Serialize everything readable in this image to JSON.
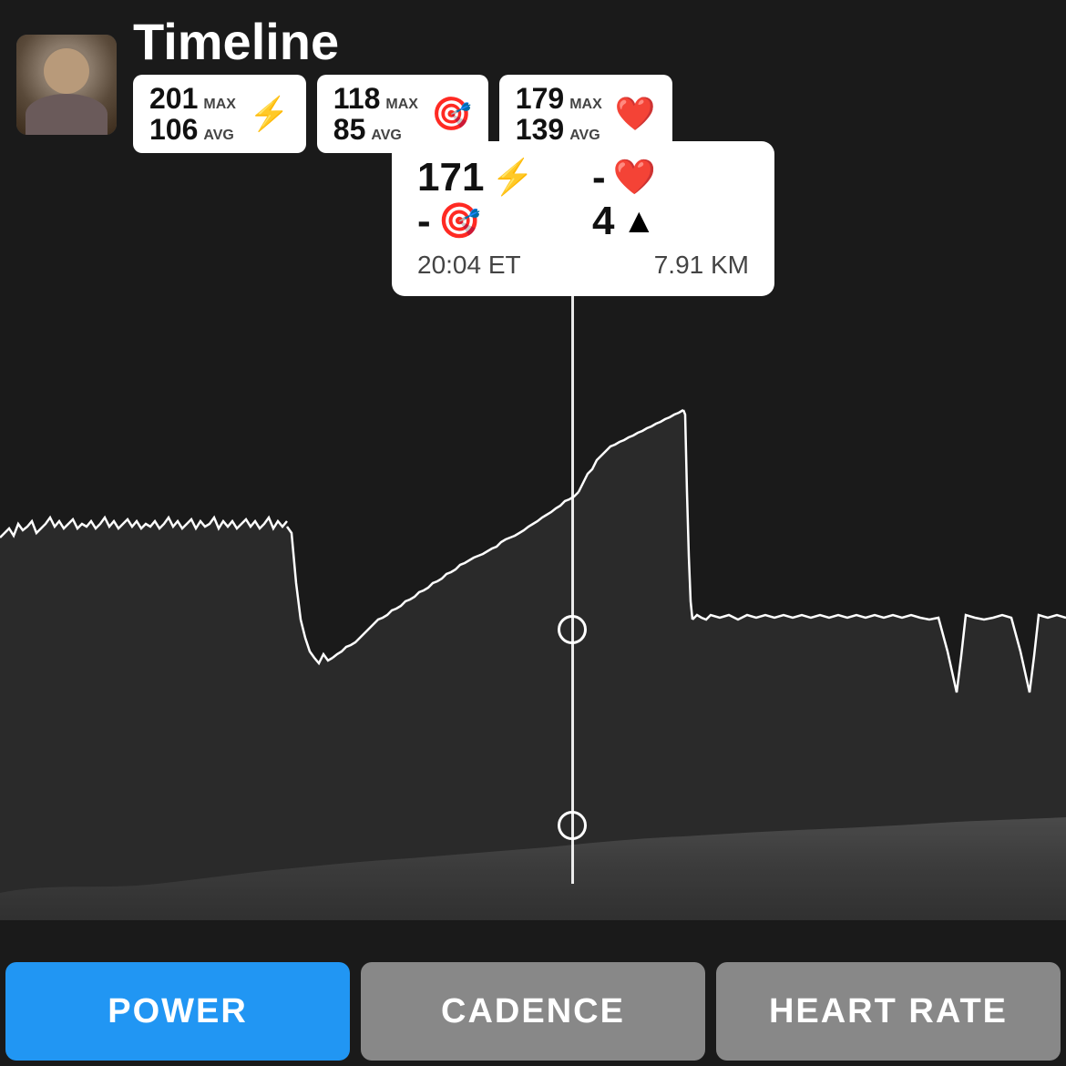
{
  "header": {
    "title": "Timeline",
    "avatar_alt": "User avatar"
  },
  "stats": [
    {
      "id": "power",
      "max_label": "MAX",
      "avg_label": "AVG",
      "max_val": "201",
      "avg_val": "106",
      "icon": "⚡",
      "icon_name": "power-icon"
    },
    {
      "id": "cadence",
      "max_label": "MAX",
      "avg_label": "AVG",
      "max_val": "118",
      "avg_val": "85",
      "icon": "🎯",
      "icon_name": "cadence-icon"
    },
    {
      "id": "heartrate",
      "max_label": "MAX",
      "avg_label": "AVG",
      "max_val": "179",
      "avg_val": "139",
      "icon": "❤️",
      "icon_name": "heartrate-icon"
    }
  ],
  "tooltip": {
    "power_val": "171",
    "power_icon": "⚡",
    "heart_dash": "-",
    "heart_icon": "❤️",
    "cadence_dash": "-",
    "cadence_icon": "🎯",
    "elevation_val": "4",
    "elevation_icon": "▲",
    "time_val": "20:04",
    "time_label": "ET",
    "distance_val": "7.91",
    "distance_label": "KM"
  },
  "tabs": [
    {
      "id": "power",
      "label": "POWER",
      "active": true
    },
    {
      "id": "cadence",
      "label": "CADENCE",
      "active": false
    },
    {
      "id": "heartrate",
      "label": "HEART RATE",
      "active": false
    }
  ],
  "colors": {
    "active_tab": "#2196F3",
    "inactive_tab": "#888888",
    "heart_color": "#e53935",
    "cadence_color": "#29b6f6",
    "background": "#1a1a1a"
  }
}
